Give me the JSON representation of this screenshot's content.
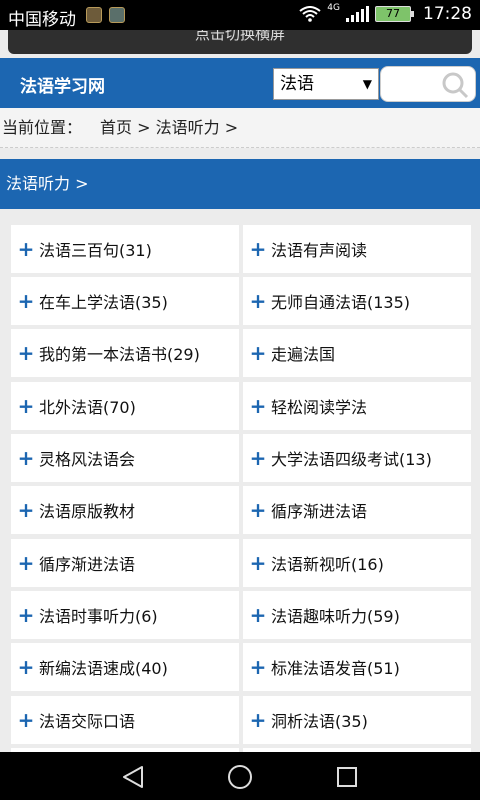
{
  "status_bar": {
    "carrier": "中国移动",
    "network": "4G",
    "battery": "77",
    "time": "17:28"
  },
  "toast": {
    "text": "点击切换横屏"
  },
  "header": {
    "site_title": "法语学习网",
    "language_select": {
      "selected": "法语"
    },
    "search": {
      "placeholder": ""
    }
  },
  "breadcrumb": {
    "prefix": "当前位置：",
    "home": "首页",
    "separator1": " > ",
    "current": "法语听力",
    "separator2": " >"
  },
  "section": {
    "title": "法语听力 >"
  },
  "categories": [
    {
      "label": "法语三百句(31)"
    },
    {
      "label": "法语有声阅读"
    },
    {
      "label": "在车上学法语(35)"
    },
    {
      "label": "无师自通法语(135)"
    },
    {
      "label": "我的第一本法语书(29)"
    },
    {
      "label": "走遍法国"
    },
    {
      "label": "北外法语(70)"
    },
    {
      "label": "轻松阅读学法"
    },
    {
      "label": "灵格风法语会"
    },
    {
      "label": "大学法语四级考试(13)"
    },
    {
      "label": "法语原版教材"
    },
    {
      "label": "循序渐进法语"
    },
    {
      "label": "循序渐进法语"
    },
    {
      "label": "法语新视听(16)"
    },
    {
      "label": "法语时事听力(6)"
    },
    {
      "label": "法语趣味听力(59)"
    },
    {
      "label": "新编法语速成(40)"
    },
    {
      "label": "标准法语发音(51)"
    },
    {
      "label": "法语交际口语"
    },
    {
      "label": "洞析法语(35)"
    }
  ],
  "colors": {
    "primary_blue": "#1c66b1",
    "background": "#ececec"
  },
  "icons": {
    "search": "search-icon",
    "plus": "plus-icon",
    "back": "back-icon",
    "home": "home-icon",
    "recent": "recent-apps-icon"
  }
}
